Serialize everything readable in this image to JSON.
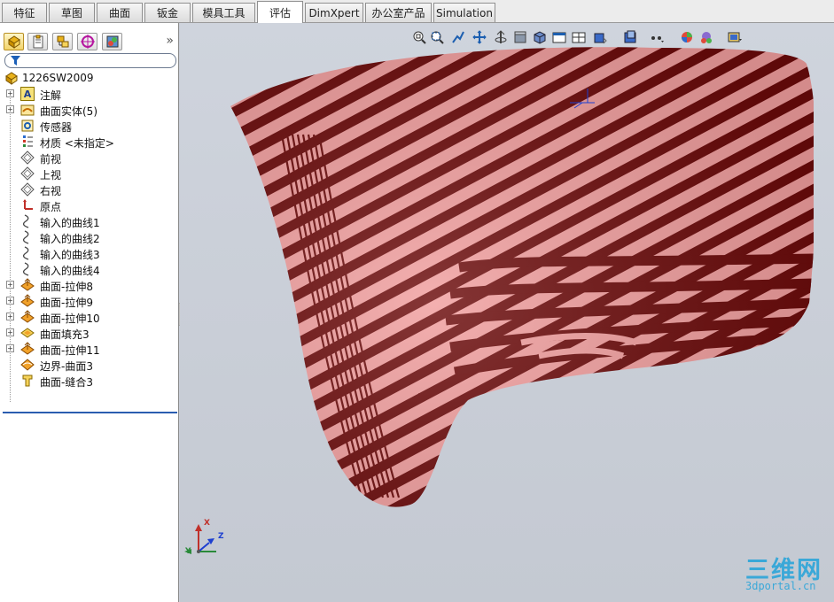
{
  "tabs": [
    "特征",
    "草图",
    "曲面",
    "钣金",
    "模具工具",
    "评估",
    "DimXpert",
    "办公室产品",
    "Simulation"
  ],
  "active_tab": "评估",
  "panel": {
    "expand_glyph": "»",
    "tabs": [
      "featuremanager-icon",
      "propertymanager-icon",
      "configurationmanager-icon",
      "dimxpertmanager-icon",
      "displaymanager-icon"
    ],
    "filter_icon": "filter-icon"
  },
  "tree": {
    "root": "1226SW2009",
    "items": [
      {
        "label": "注解",
        "icon": "annotations-icon",
        "expandable": true
      },
      {
        "label": "曲面实体(5)",
        "icon": "surface-bodies-icon",
        "expandable": true
      },
      {
        "label": "传感器",
        "icon": "sensor-icon",
        "expandable": false
      },
      {
        "label": "材质 <未指定>",
        "icon": "material-icon",
        "expandable": false
      },
      {
        "label": "前视",
        "icon": "plane-icon",
        "expandable": false
      },
      {
        "label": "上视",
        "icon": "plane-icon",
        "expandable": false
      },
      {
        "label": "右视",
        "icon": "plane-icon",
        "expandable": false
      },
      {
        "label": "原点",
        "icon": "origin-icon",
        "expandable": false
      },
      {
        "label": "输入的曲线1",
        "icon": "curve-icon",
        "expandable": false
      },
      {
        "label": "输入的曲线2",
        "icon": "curve-icon",
        "expandable": false
      },
      {
        "label": "输入的曲线3",
        "icon": "curve-icon",
        "expandable": false
      },
      {
        "label": "输入的曲线4",
        "icon": "curve-icon",
        "expandable": false
      },
      {
        "label": "曲面-拉伸8",
        "icon": "surface-extrude-icon",
        "expandable": true
      },
      {
        "label": "曲面-拉伸9",
        "icon": "surface-extrude-icon",
        "expandable": true
      },
      {
        "label": "曲面-拉伸10",
        "icon": "surface-extrude-icon",
        "expandable": true
      },
      {
        "label": "曲面填充3",
        "icon": "surface-fill-icon",
        "expandable": true
      },
      {
        "label": "曲面-拉伸11",
        "icon": "surface-extrude-icon",
        "expandable": true
      },
      {
        "label": "边界-曲面3",
        "icon": "boundary-surface-icon",
        "expandable": false
      },
      {
        "label": "曲面-缝合3",
        "icon": "knit-surface-icon",
        "expandable": false
      }
    ]
  },
  "view_toolbar": [
    "zoom-to-fit-icon",
    "zoom-to-area-icon",
    "previous-view-icon",
    "pan-icon",
    "rotate-icon",
    "section-view-icon",
    "view-orientation-icon",
    "display-style-icon",
    "hide-show-icon",
    "edit-appearance-icon",
    "apply-scene-icon",
    "view-settings-icon"
  ],
  "triad": {
    "x": "X",
    "y": "Y",
    "z": "Z"
  },
  "watermark": {
    "main": "三维网",
    "sub": "3dportal.cn"
  },
  "colors": {
    "stripe_dark": "#6b0a0a",
    "stripe_light": "#f2a0a0",
    "background": "#c9ced8",
    "watermark": "#3aa8d8",
    "accent": "#2a5db0"
  }
}
